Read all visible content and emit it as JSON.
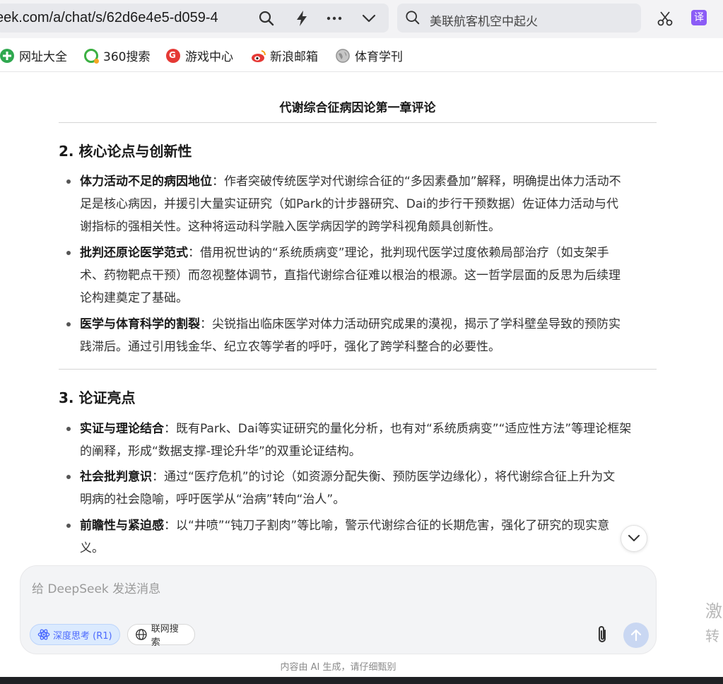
{
  "browser": {
    "url_visible": "eek.com/a/chat/s/62d6e4e5-d059-4",
    "search_placeholder": "美联航客机空中起火",
    "translate_label": "译"
  },
  "bookmarks": [
    {
      "label": "网址大全",
      "icon": "plus-circle-icon",
      "color": "#2fa84f"
    },
    {
      "label": "360搜索",
      "icon": "search-360-icon",
      "color": "#f5a623"
    },
    {
      "label": "游戏中心",
      "icon": "game-center-icon",
      "color": "#e53935"
    },
    {
      "label": "新浪邮箱",
      "icon": "sina-mail-icon",
      "color": "#e53935"
    },
    {
      "label": "体育学刊",
      "icon": "globe-icon",
      "color": "#9e9e9e"
    }
  ],
  "content": {
    "doc_title": "代谢综合征病因论第一章评论",
    "section2": {
      "heading": "2. 核心论点与创新性",
      "items": [
        {
          "bold": "体力活动不足的病因地位",
          "line1": "：作者突破传统医学对代谢综合征的“多因素叠加”解释，明确提出体力活动不",
          "line2": "足是核心病因，并援引大量实证研究（如Park的计步器研究、Dai的步行干预数据）佐证体力活动与代",
          "line3": "谢指标的强相关性。这种将运动科学融入医学病因学的跨学科视角颇具创新性。"
        },
        {
          "bold": "批判还原论医学范式",
          "line1": "：借用祝世讷的“系统质病变”理论，批判现代医学过度依赖局部治疗（如支架手",
          "line2": "术、药物靶点干预）而忽视整体调节，直指代谢综合征难以根治的根源。这一哲学层面的反思为后续理",
          "line3": "论构建奠定了基础。"
        },
        {
          "bold": "医学与体育科学的割裂",
          "line1": "：尖锐指出临床医学对体力活动研究成果的漠视，揭示了学科壁垒导致的预防实",
          "line2": "践滞后。通过引用钱金华、纪立农等学者的呼吁，强化了跨学科整合的必要性。"
        }
      ]
    },
    "section3": {
      "heading": "3. 论证亮点",
      "items": [
        {
          "bold": "实证与理论结合",
          "line1": "：既有Park、Dai等实证研究的量化分析，也有对“系统质病变”“适应性方法”等理论框架",
          "line2": "的阐释，形成“数据支撑-理论升华”的双重论证结构。"
        },
        {
          "bold": "社会批判意识",
          "line1": "：通过“医疗危机”的讨论（如资源分配失衡、预防医学边缘化），将代谢综合征上升为文",
          "line2": "明病的社会隐喻，呼吁医学从“治病”转向“治人”。"
        },
        {
          "bold": "前瞻性与紧迫感",
          "line1": "：以“井喷”“钝刀子割肉”等比喻，警示代谢综合征的长期危害，强化了研究的现实意",
          "line2": "义。"
        }
      ]
    }
  },
  "composer": {
    "placeholder": "给 DeepSeek 发送消息",
    "deep_think_label": "深度思考 (R1)",
    "web_search_label": "联网搜索",
    "disclaimer": "内容由 AI 生成，请仔细甄别"
  },
  "side_ghost": {
    "line1": "激",
    "line2": "转"
  },
  "colors": {
    "accent": "#4d6bfe",
    "translate": "#8b5cf6"
  }
}
